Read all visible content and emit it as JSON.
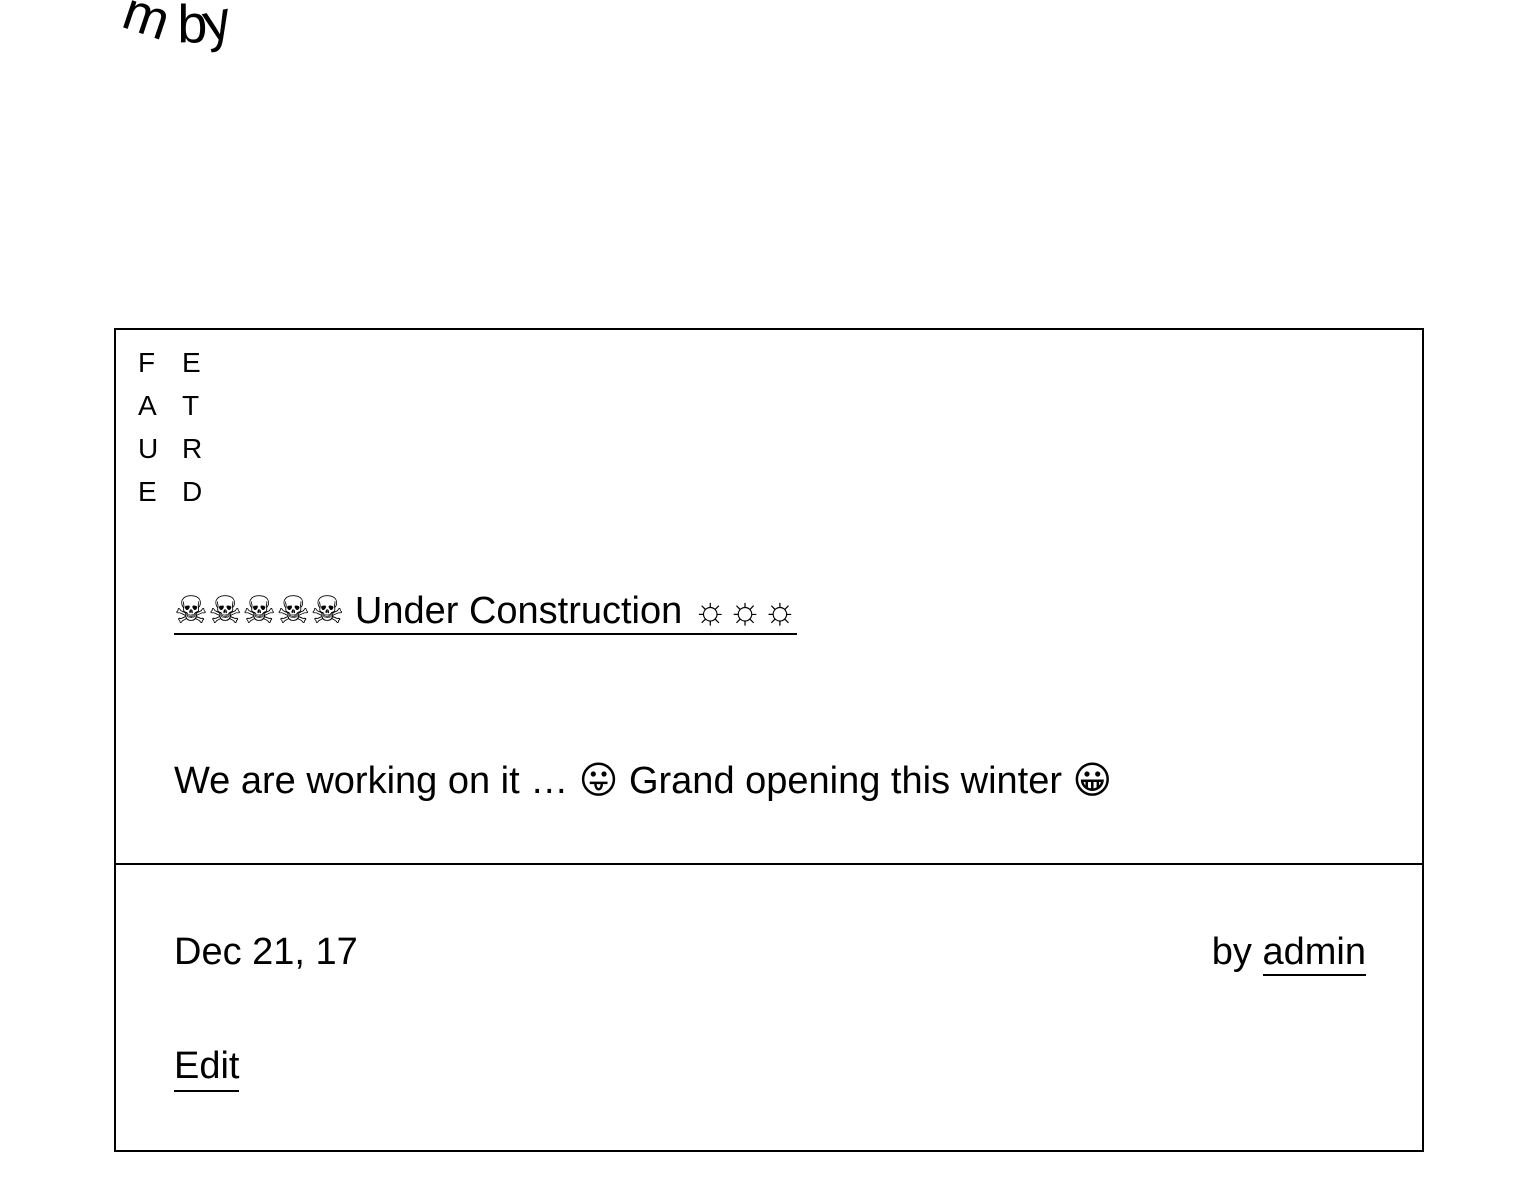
{
  "header": {
    "arc_fragment_text": "m  by"
  },
  "post": {
    "featured_letters": [
      "F",
      "E",
      "A",
      "T",
      "U",
      "R",
      "E",
      "D"
    ],
    "title": "☠☠☠☠☠ Under Construction ☼☼☼",
    "excerpt": "We are working on it … 😛 Grand opening this winter 😀",
    "date": "Dec 21, 17",
    "byline_prefix": "by",
    "author": "admin",
    "edit_label": "Edit"
  }
}
